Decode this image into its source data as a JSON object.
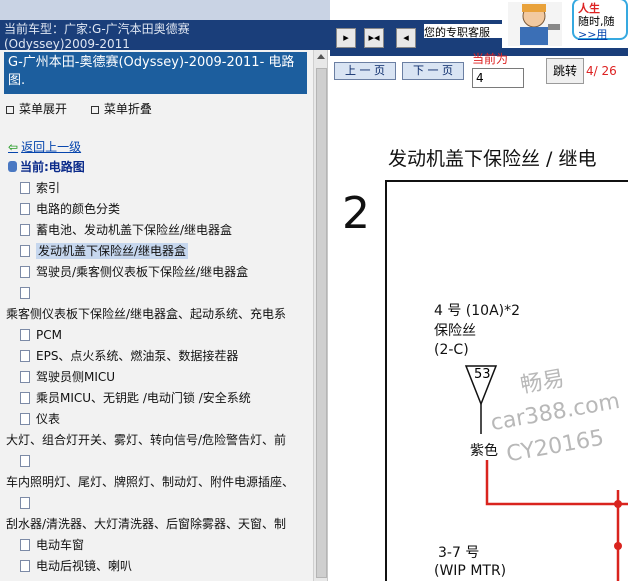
{
  "header": {
    "car_label": "当前车型：广家:G-广汽本田奥德赛(Odyssey)2009-2011"
  },
  "left_panel": {
    "title": "G-广州本田-奥德赛(Odyssey)-2009-2011- 电路图.",
    "expand_label": "菜单展开",
    "collapse_label": "菜单折叠",
    "back_label": "返回上一级",
    "current_label": "当前:电路图",
    "tree": [
      {
        "label": "索引",
        "top": false,
        "selected": false
      },
      {
        "label": "电路的颜色分类",
        "top": false,
        "selected": false
      },
      {
        "label": "蓄电池、发动机盖下保险丝/继电器盒",
        "top": false,
        "selected": false
      },
      {
        "label": "发动机盖下保险丝/继电器盒",
        "top": false,
        "selected": true
      },
      {
        "label": "驾驶员/乘客侧仪表板下保险丝/继电器盒",
        "top": false,
        "selected": false
      },
      {
        "label": "",
        "top": false,
        "selected": false
      },
      {
        "label": "乘客侧仪表板下保险丝/继电器盒、起动系统、充电系",
        "top": true,
        "selected": false
      },
      {
        "label": "PCM",
        "top": false,
        "selected": false
      },
      {
        "label": "EPS、点火系统、燃油泵、数据接茬器",
        "top": false,
        "selected": false
      },
      {
        "label": "驾驶员侧MICU",
        "top": false,
        "selected": false
      },
      {
        "label": "乘员MICU、无钥匙 /电动门锁 /安全系统",
        "top": false,
        "selected": false
      },
      {
        "label": "仪表",
        "top": false,
        "selected": false
      },
      {
        "label": "大灯、组合灯开关、雾灯、转向信号/危险警告灯、前",
        "top": true,
        "selected": false
      },
      {
        "label": "",
        "top": false,
        "selected": false
      },
      {
        "label": "车内照明灯、尾灯、牌照灯、制动灯、附件电源插座、",
        "top": true,
        "selected": false
      },
      {
        "label": "",
        "top": false,
        "selected": false
      },
      {
        "label": "刮水器/清洗器、大灯清洗器、后窗除雾器、天窗、制",
        "top": true,
        "selected": false
      },
      {
        "label": "电动车窗",
        "top": false,
        "selected": false
      },
      {
        "label": "电动后视镜、喇叭",
        "top": false,
        "selected": false
      }
    ]
  },
  "toolbar": {
    "dedicated_label": "您的专职客服",
    "prev_label": "上 一 页",
    "next_label": "下 一 页",
    "current_label": "当前为",
    "page_value": "4",
    "jump_label": "跳转",
    "page_count": "4/ 26"
  },
  "ad": {
    "line1": "人生",
    "line2": "随时,随",
    "line3": ">>用"
  },
  "diagram": {
    "title": "发动机盖下保险丝 / 继电",
    "section_number": "2",
    "fuse_line1": "4 号 (10A)*2",
    "fuse_line2": "保险丝",
    "fuse_line3": "(2-C)",
    "connector_number": "53",
    "wire_color": "紫色",
    "bottom_line1": "3-7 号",
    "bottom_line2": "(WIP MTR)",
    "watermark1": "畅易",
    "watermark2": "car388.com",
    "watermark3": "CY20165",
    "wire_color_hex": "#d9241e"
  }
}
